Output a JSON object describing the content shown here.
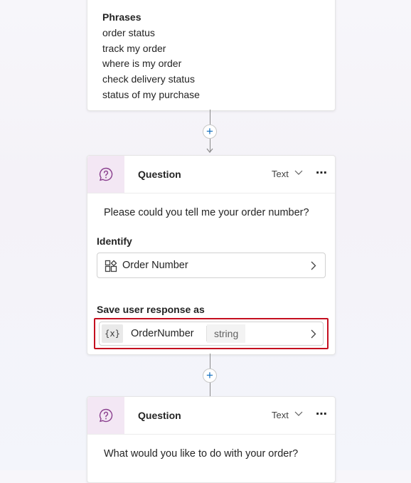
{
  "trigger": {
    "phrases_title": "Phrases",
    "phrases": [
      "order status",
      "track my order",
      "where is my order",
      "check delivery status",
      "status of my purchase"
    ]
  },
  "node1": {
    "title": "Question",
    "type_label": "Text",
    "more_label": "⋯",
    "prompt": "Please could you tell me your order number?",
    "identify_label": "Identify",
    "identify_value": "Order Number",
    "save_label": "Save user response as",
    "var_chip": "{x}",
    "var_name": "OrderNumber",
    "var_type": "string"
  },
  "node2": {
    "title": "Question",
    "type_label": "Text",
    "more_label": "⋯",
    "prompt": "What would you like to do with your order?"
  },
  "add_label": "+",
  "colors": {
    "accent": "#0f6cbd",
    "highlight": "#c50f1f",
    "question_icon_bg": "#f3e7f4",
    "question_icon": "#8a3f8e"
  },
  "icons": [
    "question-icon",
    "chevron-down-icon",
    "more-icon",
    "entity-icon",
    "chevron-right-icon",
    "plus-icon",
    "arrow-down-icon"
  ]
}
